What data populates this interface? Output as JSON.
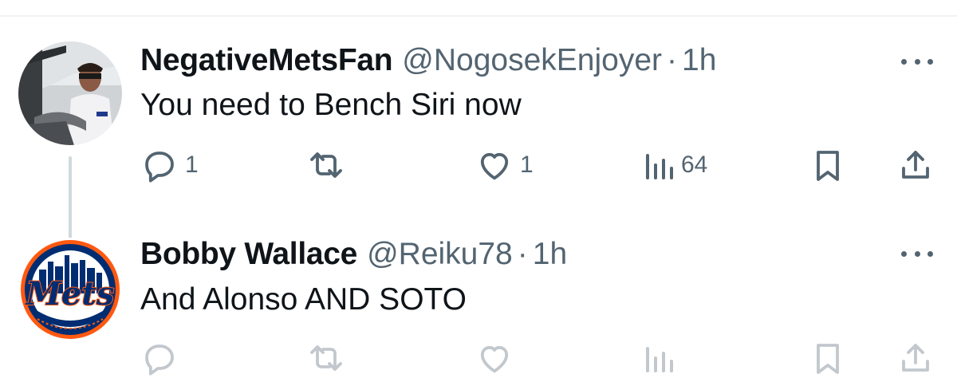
{
  "tweets": [
    {
      "display_name": "NegativeMetsFan",
      "handle": "@NogosekEnjoyer",
      "separator": "·",
      "time": "1h",
      "text": "You need to Bench Siri now",
      "avatar": "avatar-photo-man-in-car",
      "metrics": {
        "replies": "1",
        "reposts": "",
        "likes": "1",
        "views": "64"
      }
    },
    {
      "display_name": "Bobby Wallace",
      "handle": "@Reiku78",
      "separator": "·",
      "time": "1h",
      "text": "And Alonso AND SOTO",
      "avatar": "mets-logo",
      "avatar_text": "Mets",
      "metrics": {
        "replies": "",
        "reposts": "",
        "likes": "",
        "views": ""
      }
    }
  ],
  "icons": {
    "reply": "reply-icon",
    "repost": "repost-icon",
    "like": "like-icon",
    "views": "views-icon",
    "bookmark": "bookmark-icon",
    "share": "share-icon",
    "more": "more-icon"
  },
  "colors": {
    "text_primary": "#0f1419",
    "text_secondary": "#536471",
    "divider": "#eff3f4",
    "thread_line": "#cfd9de",
    "mets_blue": "#002d72",
    "mets_orange": "#ff5910"
  }
}
